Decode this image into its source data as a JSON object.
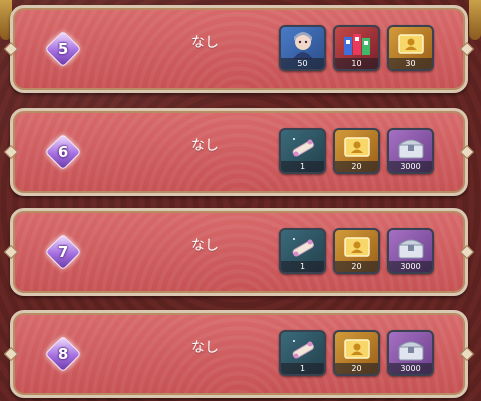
{
  "rows": [
    {
      "rank": "5",
      "status": "なし",
      "items": [
        {
          "icon": "character-portrait-icon",
          "qty": "50"
        },
        {
          "icon": "goods-bundle-icon",
          "qty": "10"
        },
        {
          "icon": "gold-ticket-icon",
          "qty": "30"
        }
      ]
    },
    {
      "rank": "6",
      "status": "なし",
      "items": [
        {
          "icon": "scroll-icon",
          "qty": "1"
        },
        {
          "icon": "gold-ticket-icon",
          "qty": "20"
        },
        {
          "icon": "treasure-chest-icon",
          "qty": "3000"
        }
      ]
    },
    {
      "rank": "7",
      "status": "なし",
      "items": [
        {
          "icon": "scroll-icon",
          "qty": "1"
        },
        {
          "icon": "gold-ticket-icon",
          "qty": "20"
        },
        {
          "icon": "treasure-chest-icon",
          "qty": "3000"
        }
      ]
    },
    {
      "rank": "8",
      "status": "なし",
      "items": [
        {
          "icon": "scroll-icon",
          "qty": "1"
        },
        {
          "icon": "gold-ticket-icon",
          "qty": "20"
        },
        {
          "icon": "treasure-chest-icon",
          "qty": "3000"
        }
      ]
    }
  ]
}
